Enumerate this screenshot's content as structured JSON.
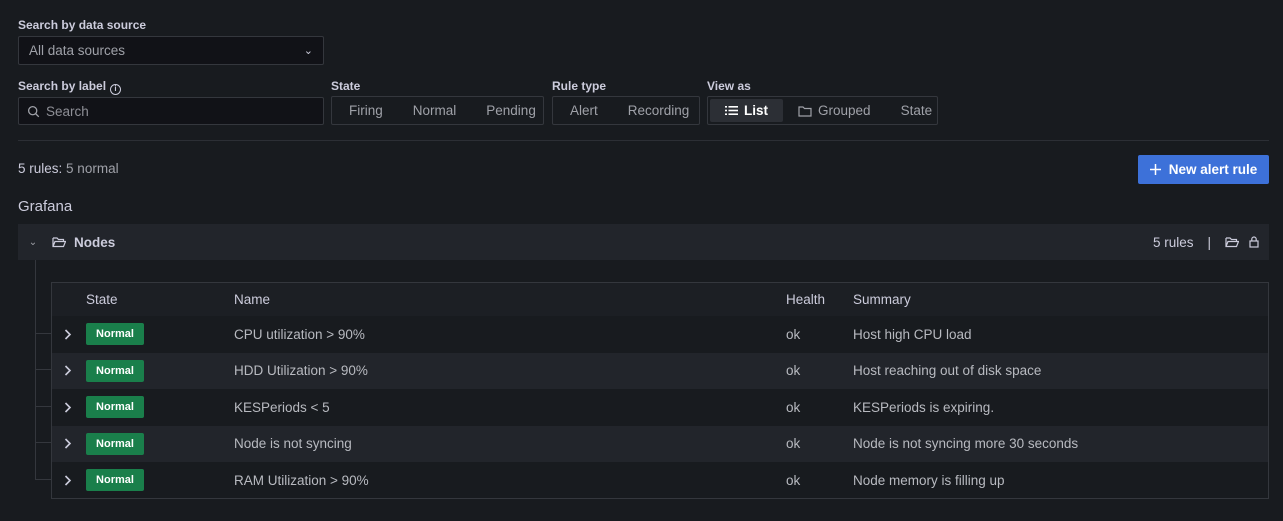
{
  "filters": {
    "datasource_label": "Search by data source",
    "datasource_value": "All data sources",
    "label_search_label": "Search by label",
    "label_search_placeholder": "Search",
    "state_label": "State",
    "state_options": [
      "Firing",
      "Normal",
      "Pending"
    ],
    "rule_type_label": "Rule type",
    "rule_type_options": [
      "Alert",
      "Recording"
    ],
    "view_as_label": "View as",
    "view_as_options": [
      "List",
      "Grouped",
      "State"
    ],
    "view_as_selected": "List"
  },
  "summary": {
    "count": "5 rules:",
    "detail": "5 normal"
  },
  "new_rule_button": "New alert rule",
  "datasource_group": "Grafana",
  "folder": {
    "name": "Nodes",
    "rule_count": "5 rules",
    "separator": "|"
  },
  "table": {
    "headers": {
      "state": "State",
      "name": "Name",
      "health": "Health",
      "summary": "Summary"
    },
    "rows": [
      {
        "state": "Normal",
        "name": "CPU utilization > 90%",
        "health": "ok",
        "summary": "Host high CPU load"
      },
      {
        "state": "Normal",
        "name": "HDD Utilization > 90%",
        "health": "ok",
        "summary": "Host reaching out of disk space"
      },
      {
        "state": "Normal",
        "name": "KESPeriods < 5",
        "health": "ok",
        "summary": "KESPeriods is expiring."
      },
      {
        "state": "Normal",
        "name": "Node is not syncing",
        "health": "ok",
        "summary": "Node is not syncing more 30 seconds"
      },
      {
        "state": "Normal",
        "name": "RAM Utilization > 90%",
        "health": "ok",
        "summary": "Node memory is filling up"
      }
    ]
  },
  "colors": {
    "accent": "#3d71d9",
    "normal_badge": "#1a7f4b",
    "background": "#181b1f"
  }
}
